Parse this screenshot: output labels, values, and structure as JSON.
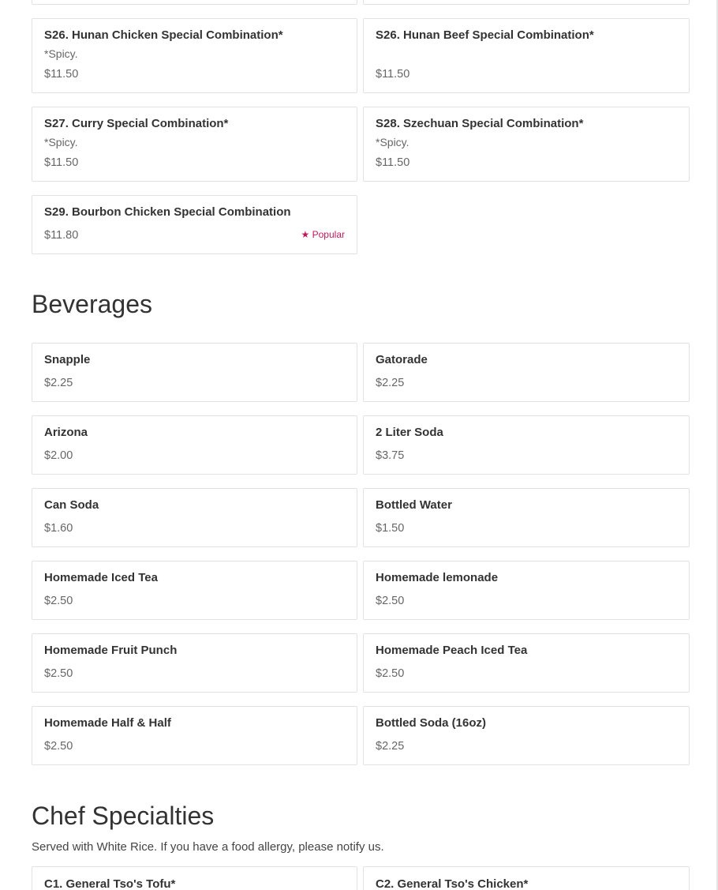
{
  "specials": {
    "items": [
      {
        "name": "S26. Hunan Chicken Special Combination*",
        "desc": "*Spicy.",
        "price": "$11.50"
      },
      {
        "name": "S26. Hunan Beef Special Combination*",
        "desc": "",
        "price": "$11.50"
      },
      {
        "name": "S27. Curry Special Combination*",
        "desc": "*Spicy.",
        "price": "$11.50"
      },
      {
        "name": "S28. Szechuan Special Combination*",
        "desc": "*Spicy.",
        "price": "$11.50"
      },
      {
        "name": "S29. Bourbon Chicken Special Combination",
        "desc": "",
        "price": "$11.80",
        "badge": "Popular",
        "badge_icon": "star-icon"
      }
    ]
  },
  "beverages": {
    "title": "Beverages",
    "items": [
      {
        "name": "Snapple",
        "price": "$2.25"
      },
      {
        "name": "Gatorade",
        "price": "$2.25"
      },
      {
        "name": "Arizona",
        "price": "$2.00"
      },
      {
        "name": "2 Liter Soda",
        "price": "$3.75"
      },
      {
        "name": "Can Soda",
        "price": "$1.60"
      },
      {
        "name": "Bottled Water",
        "price": "$1.50"
      },
      {
        "name": "Homemade Iced Tea",
        "price": "$2.50"
      },
      {
        "name": "Homemade lemonade",
        "price": "$2.50"
      },
      {
        "name": "Homemade Fruit Punch",
        "price": "$2.50"
      },
      {
        "name": "Homemade Peach Iced Tea",
        "price": "$2.50"
      },
      {
        "name": "Homemade Half & Half",
        "price": "$2.50"
      },
      {
        "name": "Bottled Soda (16oz)",
        "price": "$2.25"
      }
    ]
  },
  "chef_specialties": {
    "title": "Chef Specialties",
    "subtitle": "Served with White Rice. If you have a food allergy, please notify us.",
    "items": [
      {
        "name": "C1. General Tso's Tofu*"
      },
      {
        "name": "C2. General Tso's Chicken*"
      }
    ]
  },
  "colors": {
    "accent": "#c2185b",
    "border": "#e2e2e2",
    "text": "#333333",
    "muted": "#666666"
  }
}
